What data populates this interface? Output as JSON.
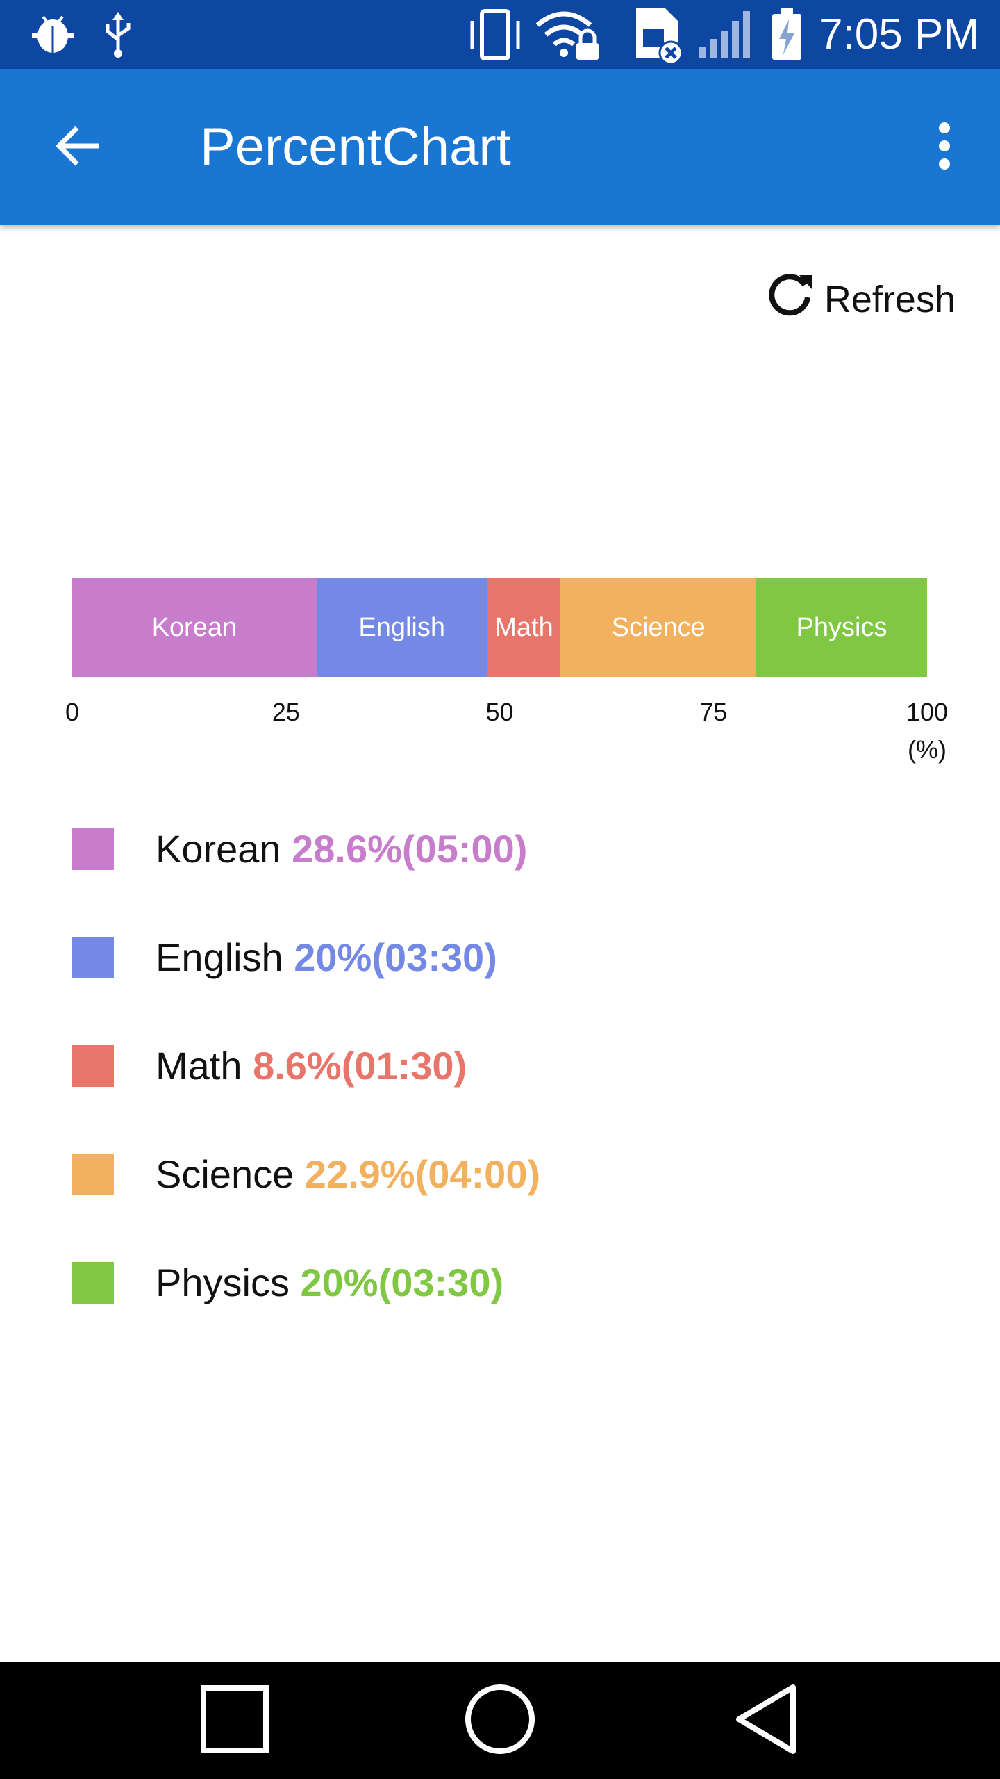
{
  "status_bar": {
    "time": "7:05 PM",
    "icons": [
      "android-debug-icon",
      "usb-icon",
      "vibrate-icon",
      "wifi-lock-icon",
      "sim-error-icon",
      "signal-icon",
      "battery-charging-icon"
    ]
  },
  "app_bar": {
    "title": "PercentChart",
    "back_icon": "arrow-back-icon",
    "menu_icon": "more-vert-icon"
  },
  "toolbar": {
    "refresh_label": "Refresh",
    "refresh_icon": "refresh-icon"
  },
  "chart_data": {
    "type": "bar",
    "orientation": "horizontal-stacked",
    "categories": [
      "Korean",
      "English",
      "Math",
      "Science",
      "Physics"
    ],
    "values": [
      28.6,
      20,
      8.6,
      22.9,
      20
    ],
    "colors": [
      "#c77dcc",
      "#7489e6",
      "#e8756a",
      "#f2b15e",
      "#80c843"
    ],
    "x_ticks": [
      "0",
      "25",
      "50",
      "75",
      "100"
    ],
    "x_unit": "(%)",
    "xlim": [
      0,
      100
    ],
    "legend": [
      {
        "name": "Korean",
        "value": "28.6%(05:00)",
        "color": "#c77dcc"
      },
      {
        "name": "English",
        "value": "20%(03:30)",
        "color": "#7489e6"
      },
      {
        "name": "Math",
        "value": "8.6%(01:30)",
        "color": "#e8756a"
      },
      {
        "name": "Science",
        "value": "22.9%(04:00)",
        "color": "#f2b15e"
      },
      {
        "name": "Physics",
        "value": "20%(03:30)",
        "color": "#80c843"
      }
    ]
  },
  "nav_bar": {
    "buttons": [
      "recents-square-icon",
      "home-circle-icon",
      "back-triangle-icon"
    ]
  }
}
